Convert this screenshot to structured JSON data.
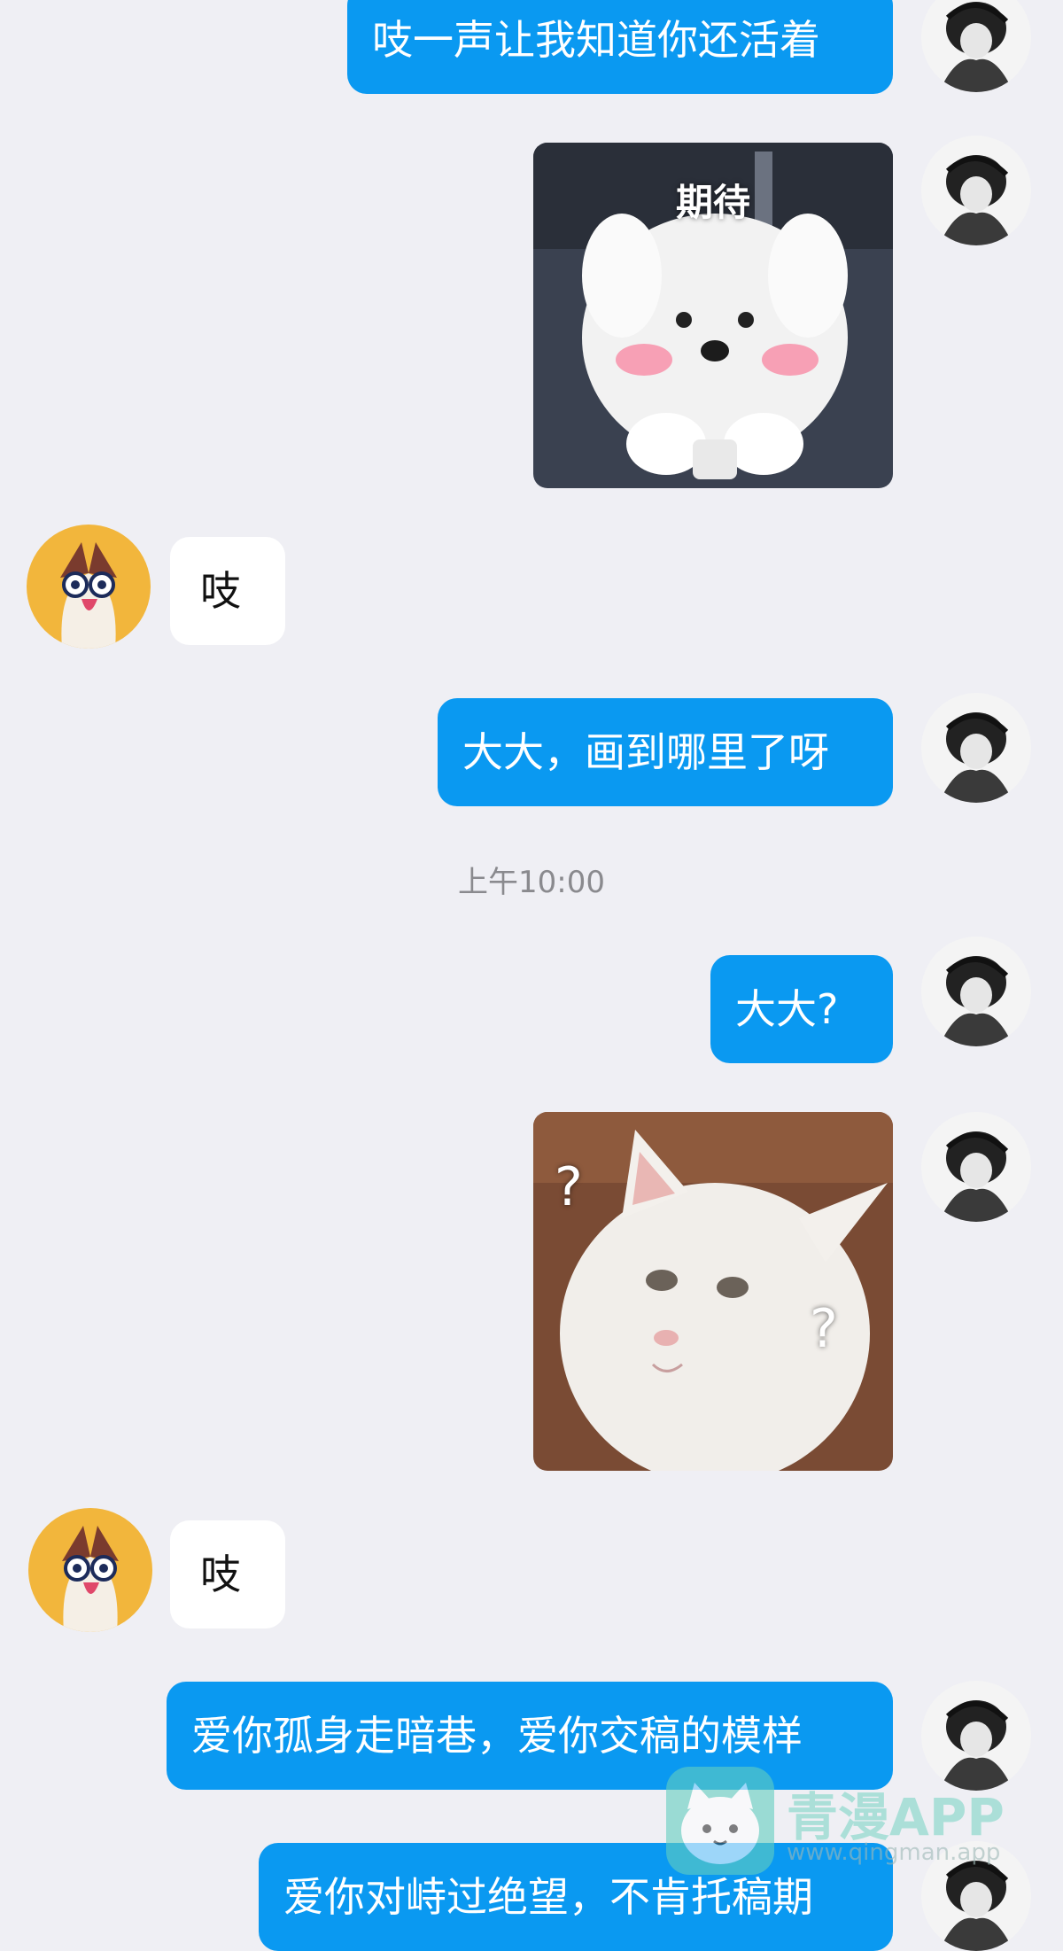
{
  "chat": {
    "messages": [
      {
        "sender": "me",
        "type": "text",
        "text": "吱一声让我知道你还活着"
      },
      {
        "sender": "me",
        "type": "sticker",
        "caption": "期待",
        "subject": "white-puppy-sticker"
      },
      {
        "sender": "them",
        "type": "text",
        "text": "吱"
      },
      {
        "sender": "me",
        "type": "text",
        "text": "大大，画到哪里了呀"
      },
      {
        "sender": "system",
        "type": "timestamp",
        "text": "上午10:00"
      },
      {
        "sender": "me",
        "type": "text",
        "text": "大大?"
      },
      {
        "sender": "me",
        "type": "sticker",
        "subject": "white-cat-sticker",
        "marks": [
          "?",
          "?"
        ]
      },
      {
        "sender": "them",
        "type": "text",
        "text": "吱"
      },
      {
        "sender": "me",
        "type": "text",
        "text": "爱你孤身走暗巷，爱你交稿的模样"
      },
      {
        "sender": "me",
        "type": "text",
        "text": "爱你对峙过绝望，不肯托稿期"
      }
    ]
  },
  "avatars": {
    "me": "ink-painting-portrait-avatar",
    "them": "cartoon-bird-avatar"
  },
  "watermark": {
    "title": "青漫APP",
    "url": "www.qingman.app",
    "mascot": "cat-mascot-icon"
  },
  "colors": {
    "background": "#efeff4",
    "outgoing_bubble": "#0a99f1",
    "incoming_bubble": "#ffffff",
    "timestamp": "#8a8a8e"
  }
}
